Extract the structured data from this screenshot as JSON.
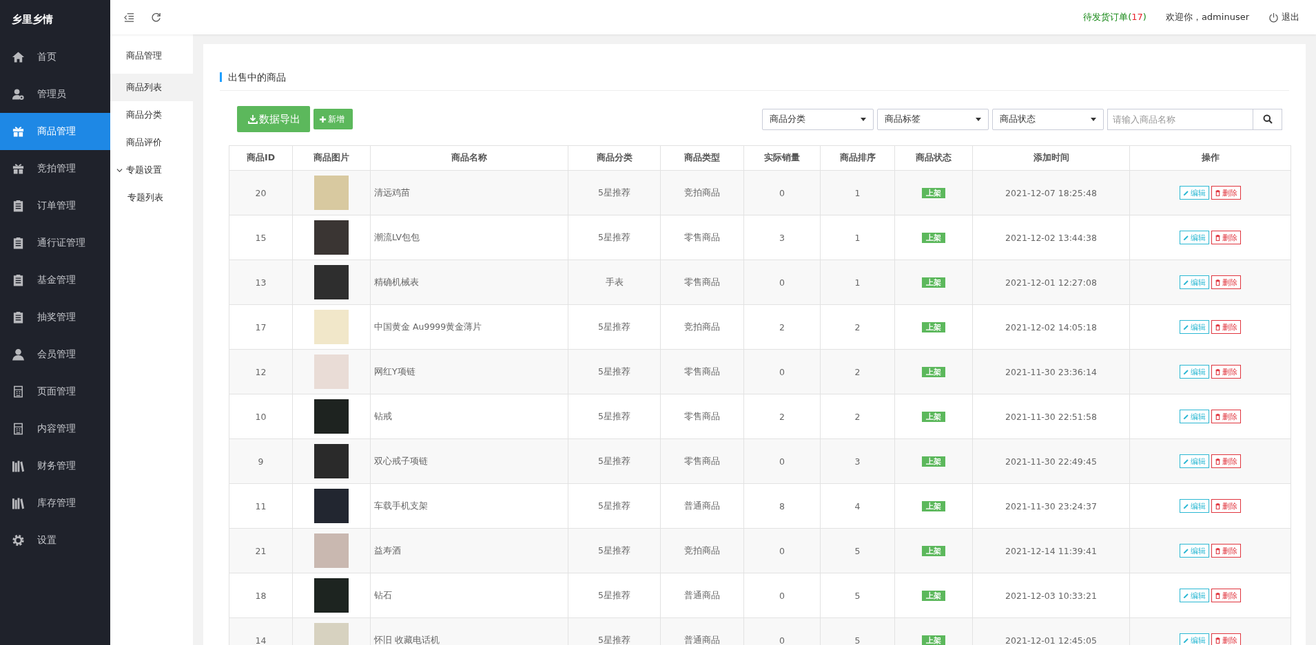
{
  "brand": "乡里乡情",
  "sidebar": {
    "items": [
      {
        "kind": "home",
        "label": "首页",
        "selected": false
      },
      {
        "kind": "admin",
        "label": "管理员",
        "selected": false
      },
      {
        "kind": "gift",
        "label": "商品管理",
        "selected": true
      },
      {
        "kind": "gift",
        "label": "竞拍管理",
        "selected": false
      },
      {
        "kind": "clipboard",
        "label": "订单管理",
        "selected": false
      },
      {
        "kind": "clipboard",
        "label": "通行证管理",
        "selected": false
      },
      {
        "kind": "clipboard",
        "label": "基金管理",
        "selected": false
      },
      {
        "kind": "clipboard",
        "label": "抽奖管理",
        "selected": false
      },
      {
        "kind": "user",
        "label": "会员管理",
        "selected": false
      },
      {
        "kind": "calculator",
        "label": "页面管理",
        "selected": false
      },
      {
        "kind": "calculator",
        "label": "内容管理",
        "selected": false
      },
      {
        "kind": "books",
        "label": "财务管理",
        "selected": false
      },
      {
        "kind": "books",
        "label": "库存管理",
        "selected": false
      },
      {
        "kind": "gear",
        "label": "设置",
        "selected": false
      }
    ]
  },
  "topbar": {
    "pending_orders": {
      "label": "待发货订单(",
      "count": "17",
      "suffix": ")"
    },
    "welcome": "欢迎你，adminuser",
    "logout": "退出"
  },
  "submenu": {
    "title": "商品管理",
    "items": [
      {
        "label": "商品列表",
        "selected": true
      },
      {
        "label": "商品分类",
        "selected": false
      },
      {
        "label": "商品评价",
        "selected": false
      },
      {
        "label": "专题设置",
        "selected": false,
        "expanded": true,
        "children": [
          {
            "label": "专题列表",
            "selected": false
          }
        ]
      }
    ]
  },
  "panel": {
    "title": "出售中的商品"
  },
  "toolbar": {
    "export": "数据导出",
    "add": "新增",
    "filters": [
      "商品分类",
      "商品标签",
      "商品状态"
    ],
    "search": {
      "placeholder": "请输入商品名称"
    }
  },
  "table": {
    "columns": [
      "商品ID",
      "商品图片",
      "商品名称",
      "商品分类",
      "商品类型",
      "实际销量",
      "商品排序",
      "商品状态",
      "添加时间",
      "操作"
    ],
    "rows": [
      {
        "id": "20",
        "name": "清远鸡苗",
        "category": "5星推荐",
        "type": "竞拍商品",
        "sales": "0",
        "sort": "1",
        "status": "上架",
        "time": "2021-12-07 18:25:48",
        "actions": [
          "编辑",
          "删除"
        ]
      },
      {
        "id": "15",
        "name": "潮流LV包包",
        "category": "5星推荐",
        "type": "零售商品",
        "sales": "3",
        "sort": "1",
        "status": "上架",
        "time": "2021-12-02 13:44:38",
        "actions": [
          "编辑",
          "删除"
        ]
      },
      {
        "id": "13",
        "name": "精确机械表",
        "category": "手表",
        "type": "零售商品",
        "sales": "0",
        "sort": "1",
        "status": "上架",
        "time": "2021-12-01 12:27:08",
        "actions": [
          "编辑",
          "删除"
        ]
      },
      {
        "id": "17",
        "name": "中国黄金 Au9999黄金薄片",
        "category": "5星推荐",
        "type": "竞拍商品",
        "sales": "2",
        "sort": "2",
        "status": "上架",
        "time": "2021-12-02 14:05:18",
        "actions": [
          "编辑",
          "删除"
        ]
      },
      {
        "id": "12",
        "name": "网红Y项链",
        "category": "5星推荐",
        "type": "零售商品",
        "sales": "0",
        "sort": "2",
        "status": "上架",
        "time": "2021-11-30 23:36:14",
        "actions": [
          "编辑",
          "删除"
        ]
      },
      {
        "id": "10",
        "name": "钻戒",
        "category": "5星推荐",
        "type": "零售商品",
        "sales": "2",
        "sort": "2",
        "status": "上架",
        "time": "2021-11-30 22:51:58",
        "actions": [
          "编辑",
          "删除"
        ]
      },
      {
        "id": "9",
        "name": "双心戒子项链",
        "category": "5星推荐",
        "type": "零售商品",
        "sales": "0",
        "sort": "3",
        "status": "上架",
        "time": "2021-11-30 22:49:45",
        "actions": [
          "编辑",
          "删除"
        ]
      },
      {
        "id": "11",
        "name": "车载手机支架",
        "category": "5星推荐",
        "type": "普通商品",
        "sales": "8",
        "sort": "4",
        "status": "上架",
        "time": "2021-11-30 23:24:37",
        "actions": [
          "编辑",
          "删除"
        ]
      },
      {
        "id": "21",
        "name": "益寿酒",
        "category": "5星推荐",
        "type": "竞拍商品",
        "sales": "0",
        "sort": "5",
        "status": "上架",
        "time": "2021-12-14 11:39:41",
        "actions": [
          "编辑",
          "删除"
        ]
      },
      {
        "id": "18",
        "name": "钻石",
        "category": "5星推荐",
        "type": "普通商品",
        "sales": "0",
        "sort": "5",
        "status": "上架",
        "time": "2021-12-03 10:33:21",
        "actions": [
          "编辑",
          "删除"
        ]
      },
      {
        "id": "14",
        "name": "怀旧 收藏电话机",
        "category": "5星推荐",
        "type": "普通商品",
        "sales": "0",
        "sort": "5",
        "status": "上架",
        "time": "2021-12-01 12:45:05",
        "actions": [
          "编辑",
          "删除"
        ]
      }
    ]
  }
}
